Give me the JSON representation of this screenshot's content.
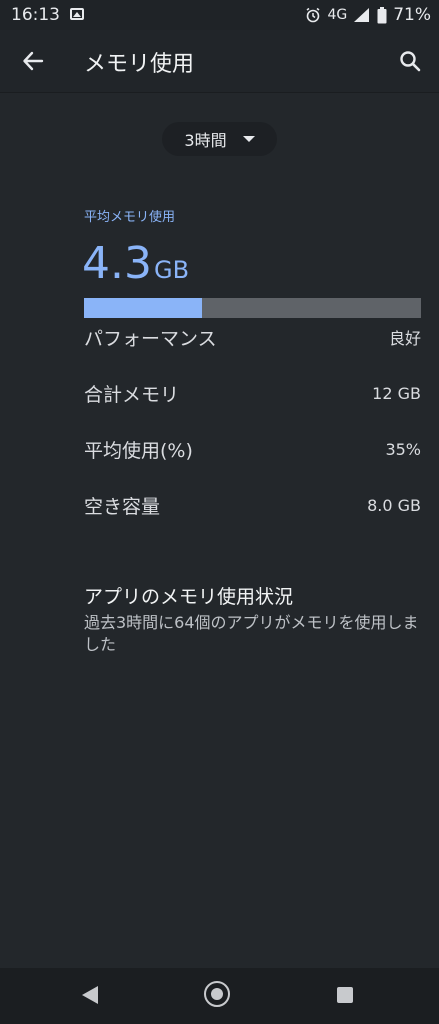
{
  "status_bar": {
    "time": "16:13",
    "network": "4G",
    "battery": "71%"
  },
  "header": {
    "title": "メモリ使用"
  },
  "time_range": {
    "selected": "3時間"
  },
  "average": {
    "label": "平均メモリ使用",
    "value": "4.3",
    "unit": "GB",
    "usage_fraction": 0.35
  },
  "stats": [
    {
      "label": "パフォーマンス",
      "value": "良好"
    },
    {
      "label": "合計メモリ",
      "value": "12 GB"
    },
    {
      "label": "平均使用(%)",
      "value": "35%"
    },
    {
      "label": "空き容量",
      "value": "8.0 GB"
    }
  ],
  "apps": {
    "title": "アプリのメモリ使用状況",
    "subtitle": "過去3時間に64個のアプリがメモリを使用しました"
  }
}
